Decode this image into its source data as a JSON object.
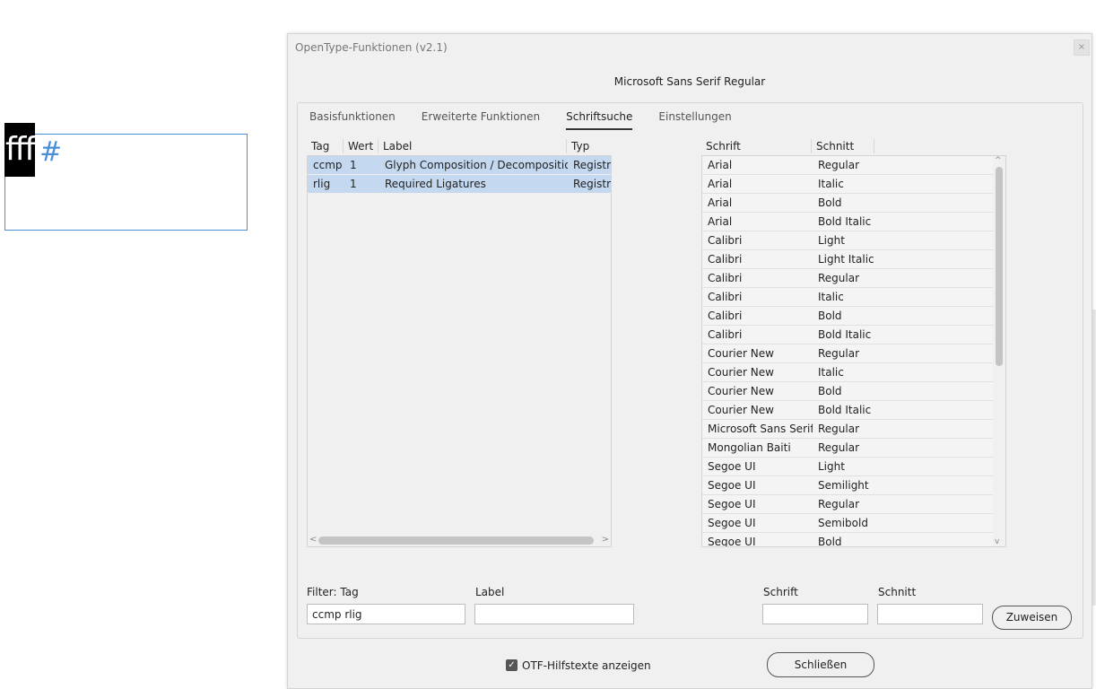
{
  "document": {
    "glyph_text": "fff",
    "hash_marker": "#"
  },
  "dialog": {
    "title": "OpenType-Funktionen (v2.1)",
    "close_symbol": "×",
    "font_name": "Microsoft Sans Serif Regular",
    "tabs": [
      {
        "label": "Basisfunktionen",
        "active": false
      },
      {
        "label": "Erweiterte Funktionen",
        "active": false
      },
      {
        "label": "Schriftsuche",
        "active": true
      },
      {
        "label": "Einstellungen",
        "active": false
      }
    ],
    "feature_table": {
      "headers": [
        "Tag",
        "Wert",
        "Label",
        "Typ"
      ],
      "rows": [
        {
          "tag": "ccmp",
          "value": "1",
          "label": "Glyph Composition / Decomposition",
          "type": "Registry"
        },
        {
          "tag": "rlig",
          "value": "1",
          "label": "Required Ligatures",
          "type": "Registry"
        }
      ],
      "scroll_left": "<",
      "scroll_right": ">"
    },
    "font_table": {
      "headers": [
        "Schrift",
        "Schnitt"
      ],
      "rows": [
        {
          "font": "Arial",
          "style": "Regular"
        },
        {
          "font": "Arial",
          "style": "Italic"
        },
        {
          "font": "Arial",
          "style": "Bold"
        },
        {
          "font": "Arial",
          "style": "Bold Italic"
        },
        {
          "font": "Calibri",
          "style": "Light"
        },
        {
          "font": "Calibri",
          "style": "Light Italic"
        },
        {
          "font": "Calibri",
          "style": "Regular"
        },
        {
          "font": "Calibri",
          "style": "Italic"
        },
        {
          "font": "Calibri",
          "style": "Bold"
        },
        {
          "font": "Calibri",
          "style": "Bold Italic"
        },
        {
          "font": "Courier New",
          "style": "Regular"
        },
        {
          "font": "Courier New",
          "style": "Italic"
        },
        {
          "font": "Courier New",
          "style": "Bold"
        },
        {
          "font": "Courier New",
          "style": "Bold Italic"
        },
        {
          "font": "Microsoft Sans Serif",
          "style": "Regular"
        },
        {
          "font": "Mongolian Baiti",
          "style": "Regular"
        },
        {
          "font": "Segoe UI",
          "style": "Light"
        },
        {
          "font": "Segoe UI",
          "style": "Semilight"
        },
        {
          "font": "Segoe UI",
          "style": "Regular"
        },
        {
          "font": "Segoe UI",
          "style": "Semibold"
        },
        {
          "font": "Segoe UI",
          "style": "Bold"
        }
      ],
      "scroll_up": "^",
      "scroll_down": "v"
    },
    "filters": {
      "tag_label": "Filter: Tag",
      "tag_value": "ccmp rlig",
      "label_label": "Label",
      "label_value": "",
      "font_label": "Schrift",
      "font_value": "",
      "style_label": "Schnitt",
      "style_value": "",
      "assign_button": "Zuweisen"
    },
    "show_otf_help": {
      "checked": true,
      "check_symbol": "✓",
      "label": "OTF-Hilfstexte anzeigen"
    },
    "close_button": "Schließen"
  },
  "colors": {
    "selection": "#c4d8f0",
    "frame_blue": "#4a8fd6",
    "dialog_bg": "#f0f0f0"
  }
}
